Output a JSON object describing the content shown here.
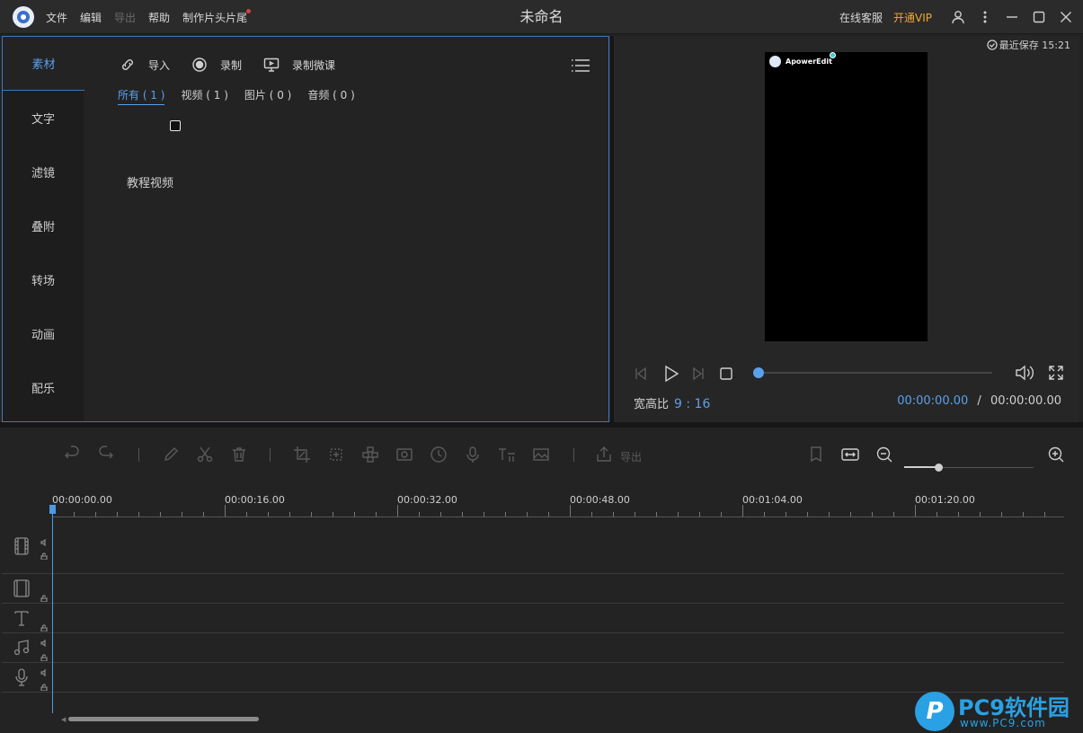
{
  "titlebar": {
    "menu": [
      "文件",
      "编辑",
      "导出",
      "帮助",
      "制作片头片尾"
    ],
    "doc_title": "未命名",
    "online_service": "在线客服",
    "vip": "开通VIP"
  },
  "library": {
    "side_tabs": [
      "素材",
      "文字",
      "滤镜",
      "叠附",
      "转场",
      "动画",
      "配乐"
    ],
    "toolbar": {
      "import": "导入",
      "record": "录制",
      "record_micro": "录制微课"
    },
    "filters": [
      "所有 ( 1 )",
      "视频 ( 1 )",
      "图片 ( 0 )",
      "音频 ( 0 )"
    ],
    "media_name": "教程视频"
  },
  "preview": {
    "saved": "最近保存 15:21",
    "watermark": "ApowerEdit",
    "ratio_label": "宽高比",
    "ratio_value": "9 : 16",
    "time_current": "00:00:00.00",
    "time_sep": "/",
    "time_total": "00:00:00.00",
    "progress": 0
  },
  "timeline": {
    "export_label": "导出",
    "ruler": [
      "00:00:00.00",
      "00:00:16.00",
      "00:00:32.00",
      "00:00:48.00",
      "00:01:04.00",
      "00:01:20.00"
    ]
  },
  "watermark": {
    "brand": "PC9软件园",
    "url": "www.PC9.com",
    "badge": "P"
  },
  "colors": {
    "accent": "#5aa0ec",
    "vip": "#f0a830",
    "panel": "#232323"
  }
}
